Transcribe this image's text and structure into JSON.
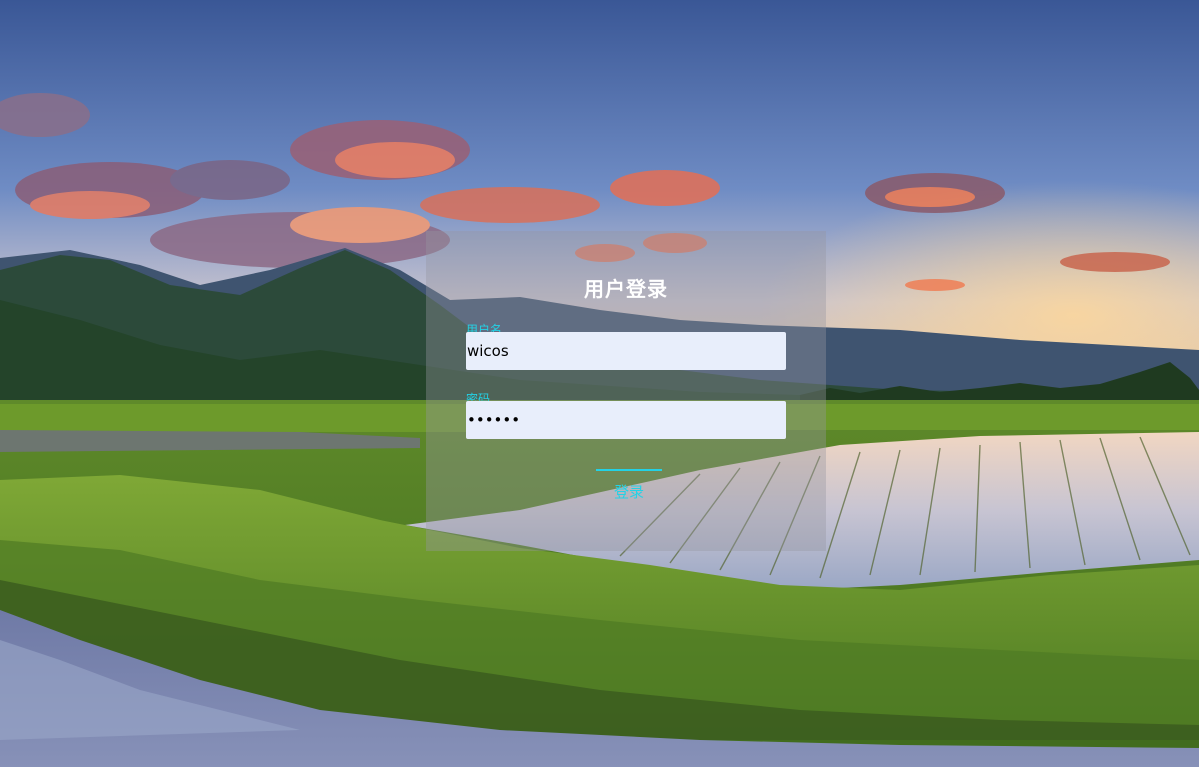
{
  "login": {
    "title": "用户登录",
    "username_label": "用户名",
    "username_value": "wicos",
    "password_label": "密码",
    "password_value": "••••••",
    "submit_label": "登录"
  },
  "colors": {
    "accent": "#23d2e6",
    "input_bg": "#e8eefb",
    "panel_bg": "rgba(150,150,160,0.38)"
  }
}
